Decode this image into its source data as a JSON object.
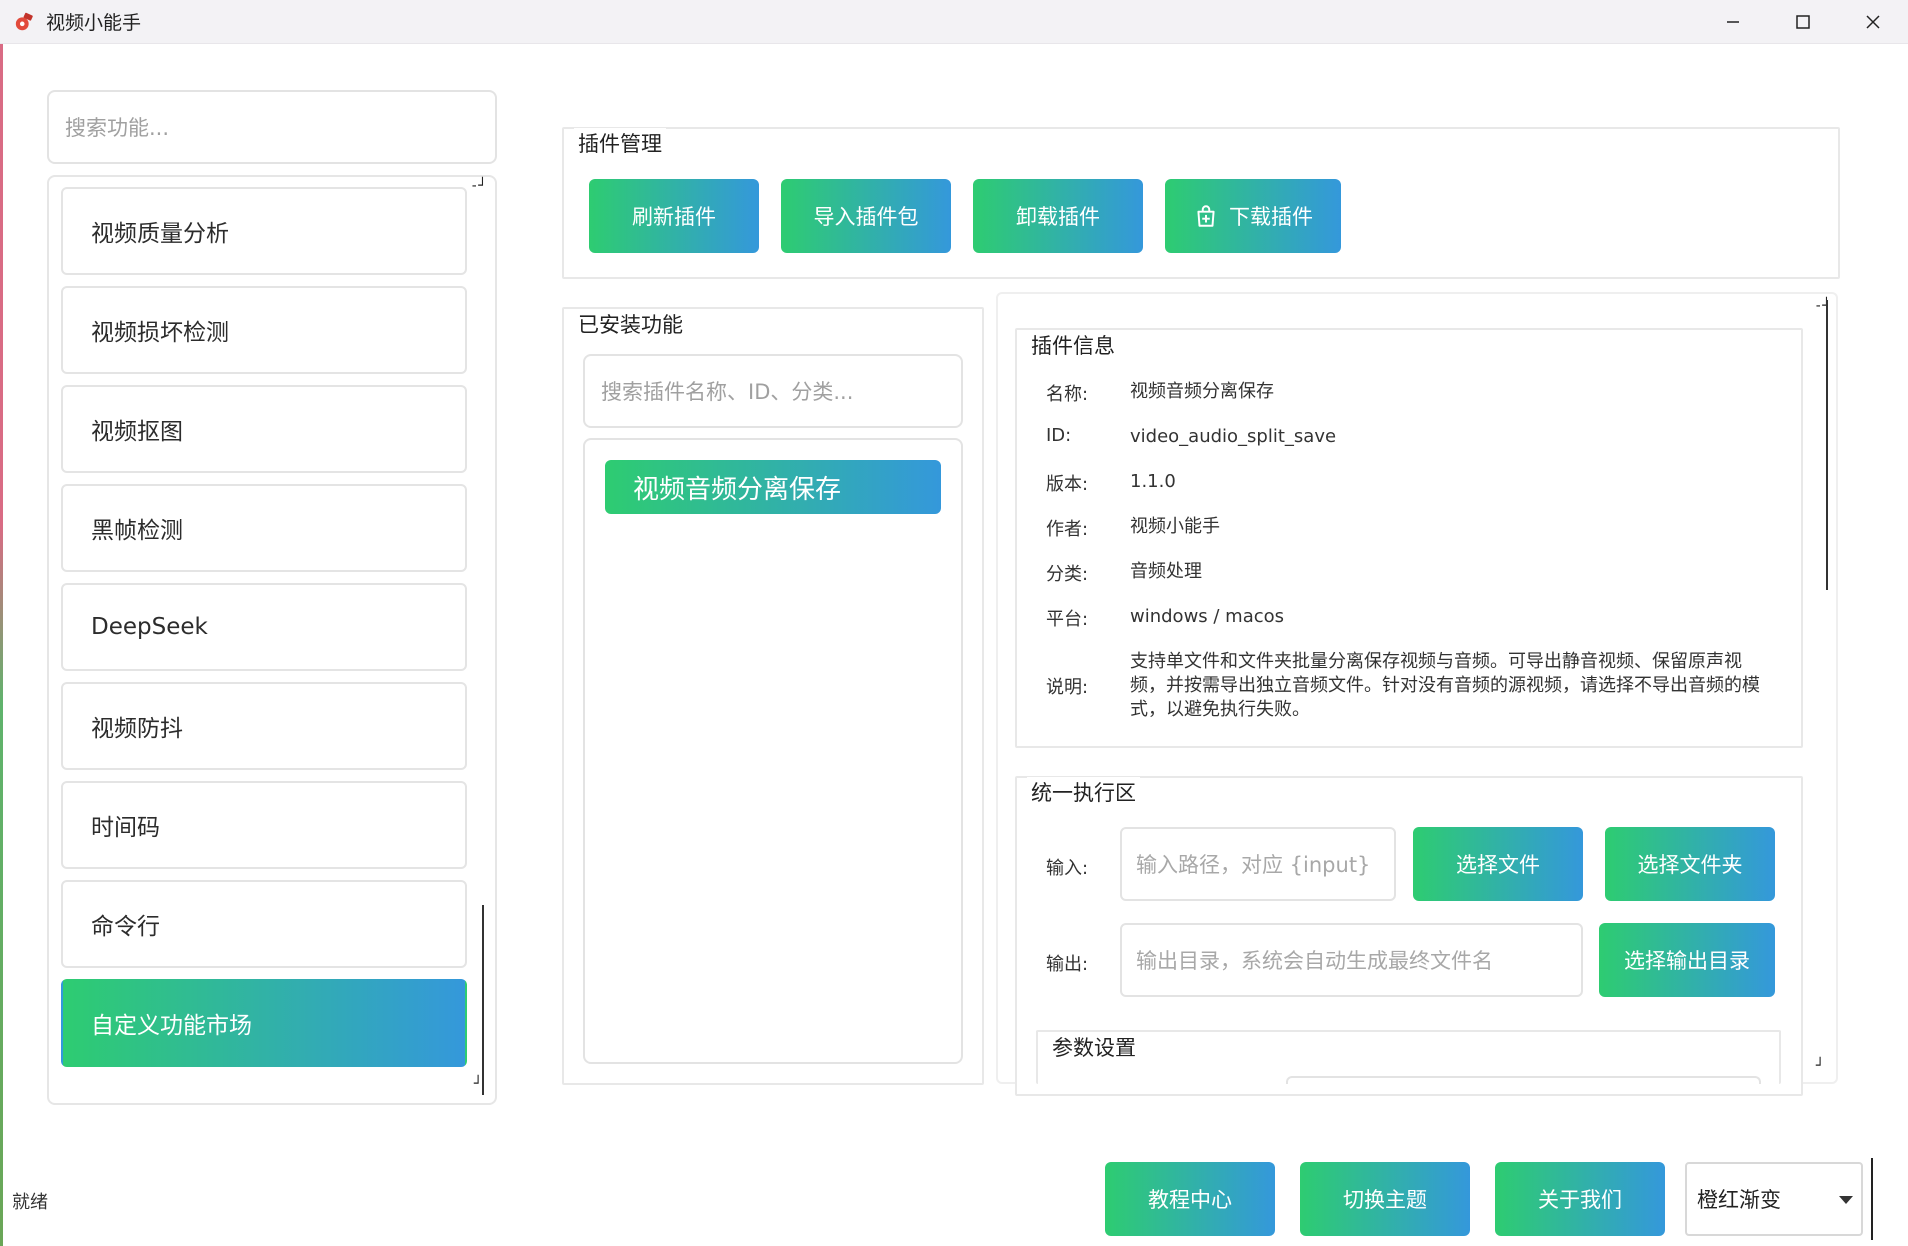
{
  "window": {
    "title": "视频小能手",
    "icon": "app-logo-icon",
    "controls": [
      "minimize-icon",
      "maximize-icon",
      "close-icon"
    ]
  },
  "sidebar": {
    "search_placeholder": "搜索功能...",
    "items": [
      {
        "label": "视频质量分析"
      },
      {
        "label": "视频损坏检测"
      },
      {
        "label": "视频抠图"
      },
      {
        "label": "黑帧检测"
      },
      {
        "label": "DeepSeek"
      },
      {
        "label": "视频防抖"
      },
      {
        "label": "时间码"
      },
      {
        "label": "命令行"
      },
      {
        "label": "自定义功能市场",
        "active": true
      }
    ]
  },
  "plugin_management": {
    "title": "插件管理",
    "buttons": {
      "refresh": "刷新插件",
      "import": "导入插件包",
      "uninstall": "卸载插件",
      "download": "下载插件"
    }
  },
  "installed": {
    "title": "已安装功能",
    "search_placeholder": "搜索插件名称、ID、分类...",
    "items": [
      "视频音频分离保存"
    ]
  },
  "plugin_info": {
    "title": "插件信息",
    "rows": [
      {
        "label": "名称:",
        "value": "视频音频分离保存"
      },
      {
        "label": "ID:",
        "value": "video_audio_split_save"
      },
      {
        "label": "版本:",
        "value": "1.1.0"
      },
      {
        "label": "作者:",
        "value": "视频小能手"
      },
      {
        "label": "分类:",
        "value": "音频处理"
      },
      {
        "label": "平台:",
        "value": "windows / macos"
      },
      {
        "label": "说明:",
        "value": "支持单文件和文件夹批量分离保存视频与音频。可导出静音视频、保留原声视频，并按需导出独立音频文件。针对没有音频的源视频，请选择不导出音频的模式，以避免执行失败。"
      }
    ]
  },
  "execution": {
    "title": "统一执行区",
    "input_label": "输入:",
    "input_placeholder": "输入路径，对应 {input}",
    "select_file": "选择文件",
    "select_folder": "选择文件夹",
    "output_label": "输出:",
    "output_placeholder": "输出目录，系统会自动生成最终文件名",
    "select_output_dir": "选择输出目录",
    "params_title": "参数设置"
  },
  "footer": {
    "status": "就绪",
    "tutorial": "教程中心",
    "switch_theme": "切换主题",
    "about": "关于我们",
    "theme_value": "橙红渐变"
  },
  "colors": {
    "gradient_start": "#2ecc71",
    "gradient_end": "#3498db",
    "titlebar_bg": "#f3f2f5"
  }
}
